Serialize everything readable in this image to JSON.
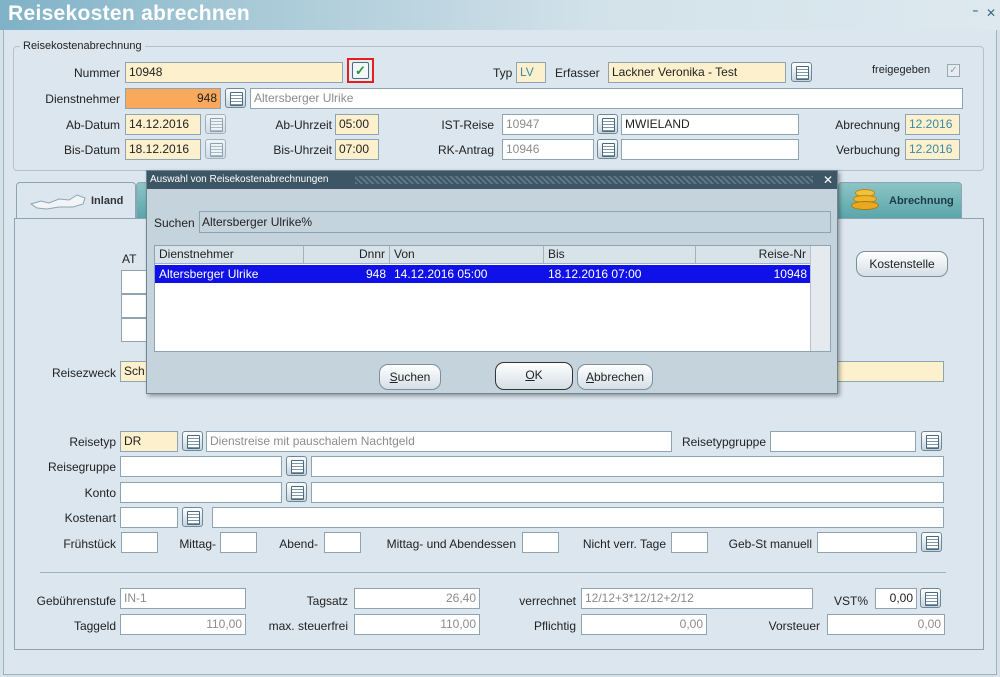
{
  "window": {
    "title": "Reisekosten abrechnen",
    "minimize_glyph": "⁼",
    "close_glyph": "✕"
  },
  "group": {
    "legend": "Reisekostenabrechnung"
  },
  "header": {
    "nummer_label": "Nummer",
    "nummer_value": "10948",
    "typ_label": "Typ",
    "typ_value": "LV",
    "erfasser_label": "Erfasser",
    "erfasser_value": "Lackner Veronika - Test",
    "freigegeben_label": "freigegeben",
    "dienstnehmer_label": "Dienstnehmer",
    "dienstnehmer_nr": "948",
    "dienstnehmer_name": "Altersberger Ulrike",
    "ab_datum_label": "Ab-Datum",
    "ab_datum": "14.12.2016",
    "ab_uhrzeit_label": "Ab-Uhrzeit",
    "ab_uhrzeit": "05:00",
    "ist_reise_label": "IST-Reise",
    "ist_reise": "10947",
    "ist_reise_name": "MWIELAND",
    "abrechnung_label": "Abrechnung",
    "abrechnung": "12.2016",
    "bis_datum_label": "Bis-Datum",
    "bis_datum": "18.12.2016",
    "bis_uhrzeit_label": "Bis-Uhrzeit",
    "bis_uhrzeit": "07:00",
    "rk_antrag_label": "RK-Antrag",
    "rk_antrag": "10946",
    "rk_antrag_name": "",
    "verbuchung_label": "Verbuchung",
    "verbuchung": "12.2016"
  },
  "tabs": {
    "inland": "Inland",
    "abrechnung": "Abrechnung"
  },
  "panel": {
    "at_header": "AT",
    "kostenstelle_button": "Kostenstelle",
    "reisezweck_label": "Reisezweck",
    "reisezweck_value": "Sch",
    "reisetyp_label": "Reisetyp",
    "reisetyp_value": "DR",
    "reisetyp_desc": "Dienstreise mit pauschalem Nachtgeld",
    "reisetypgruppe_label": "Reisetypgruppe",
    "reisetypgruppe_value": "",
    "reisegruppe_label": "Reisegruppe",
    "konto_label": "Konto",
    "kostenart_label": "Kostenart",
    "fruehstueck_label": "Frühstück",
    "mittag_label": "Mittag-",
    "abend_label": "Abend-",
    "mittag_abend_label": "Mittag- und Abendessen",
    "nicht_verr_label": "Nicht verr. Tage",
    "gebst_label": "Geb-St manuell",
    "gebuehrenstufe_label": "Gebührenstufe",
    "gebuehrenstufe_value": "IN-1",
    "tagsatz_label": "Tagsatz",
    "tagsatz_value": "26,40",
    "verrechnet_label": "verrechnet",
    "verrechnet_value": "12/12+3*12/12+2/12",
    "vst_label": "VST%",
    "vst_value": "0,00",
    "taggeld_label": "Taggeld",
    "taggeld_value": "110,00",
    "max_steuerfrei_label": "max. steuerfrei",
    "max_steuerfrei_value": "110,00",
    "pflichtig_label": "Pflichtig",
    "pflichtig_value": "0,00",
    "vorsteuer_label": "Vorsteuer",
    "vorsteuer_value": "0,00"
  },
  "dialog": {
    "title": "Auswahl von Reisekostenabrechnungen",
    "search_label": "Suchen",
    "search_value": "Altersberger Ulrike%",
    "columns": [
      "Dienstnehmer",
      "Dnnr",
      "Von",
      "Bis",
      "Reise-Nr"
    ],
    "rows": [
      {
        "dienstnehmer": "Altersberger Ulrike",
        "dnnr": "948",
        "von": "14.12.2016  05:00",
        "bis": "18.12.2016  07:00",
        "reise_nr": "10948"
      }
    ],
    "btn_suchen_key": "S",
    "btn_suchen_rest": "uchen",
    "btn_ok_key": "O",
    "btn_ok_rest": "K",
    "btn_abbrechen_key": "A",
    "btn_abbrechen_rest": "bbrechen"
  },
  "colors": {
    "accent_orange": "#f9a85c",
    "field_yellow": "#fdf0cc",
    "selection_blue": "#1010e8"
  }
}
